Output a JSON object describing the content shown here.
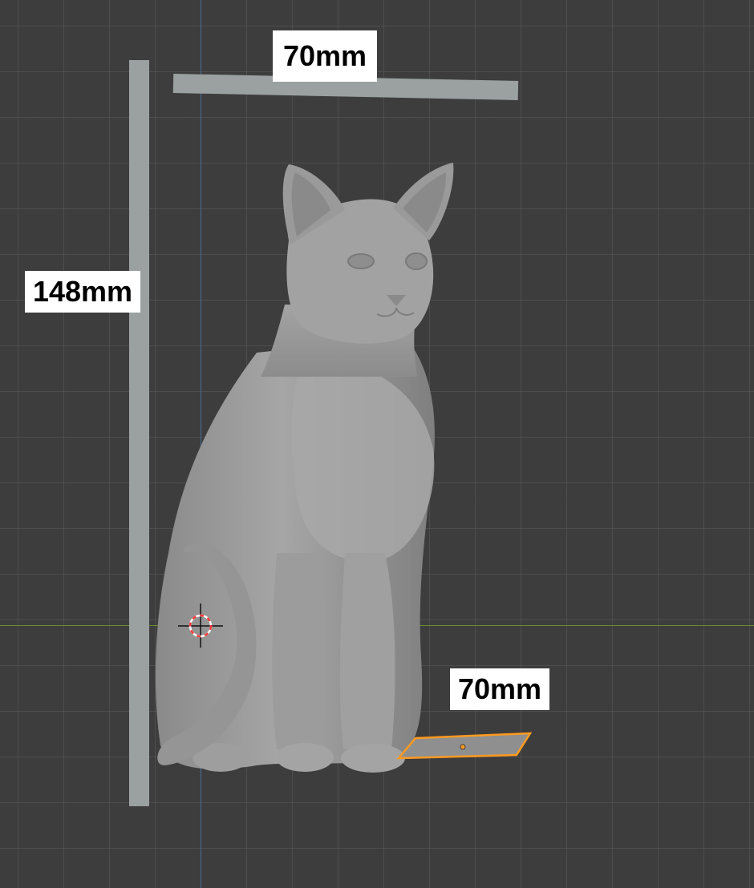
{
  "viewport": {
    "background_color": "#3d3d3d",
    "grid_color": "#5a5a5a",
    "axis_x_color": "#6a8a2e",
    "axis_y_color": "#4a6a9a"
  },
  "annotations": {
    "top_width_label": "70mm",
    "height_label": "148mm",
    "bottom_width_label": "70mm"
  },
  "model": {
    "object": "cat",
    "material_color": "#9a9a9a"
  },
  "selection": {
    "outline_color": "#ff9a1f"
  },
  "cursor_3d": {
    "icon": "3d-cursor-icon",
    "ring_colors": [
      "#ff3b3b",
      "#ffffff"
    ]
  }
}
